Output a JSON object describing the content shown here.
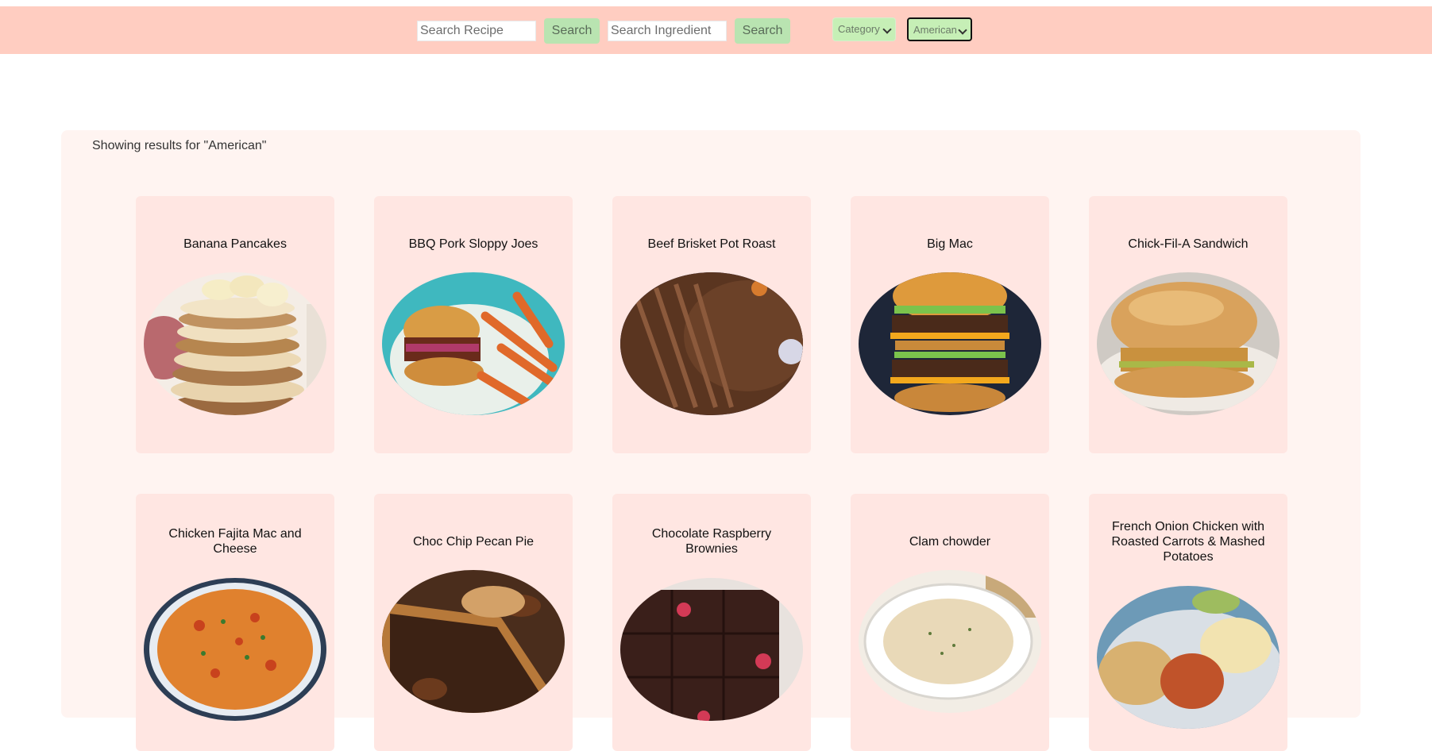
{
  "search": {
    "recipe_placeholder": "Search Recipe",
    "recipe_button": "Search",
    "ingredient_placeholder": "Search Ingredient",
    "ingredient_button": "Search"
  },
  "filters": {
    "category_selected": "Category",
    "area_selected": "American"
  },
  "results": {
    "heading": "Showing results for \"American\"",
    "items": [
      {
        "title": "Banana Pancakes"
      },
      {
        "title": "BBQ Pork Sloppy Joes"
      },
      {
        "title": "Beef Brisket Pot Roast"
      },
      {
        "title": "Big Mac"
      },
      {
        "title": "Chick-Fil-A Sandwich"
      },
      {
        "title": "Chicken Fajita Mac and Cheese"
      },
      {
        "title": "Choc Chip Pecan Pie"
      },
      {
        "title": "Chocolate Raspberry Brownies"
      },
      {
        "title": "Clam chowder"
      },
      {
        "title": "French Onion Chicken with Roasted Carrots & Mashed Potatoes"
      }
    ]
  },
  "colors": {
    "header_bg": "#ffcdc1",
    "button_bg": "#b9e4b1",
    "panel_bg": "#fff4f1",
    "card_bg": "#ffe6e2"
  }
}
